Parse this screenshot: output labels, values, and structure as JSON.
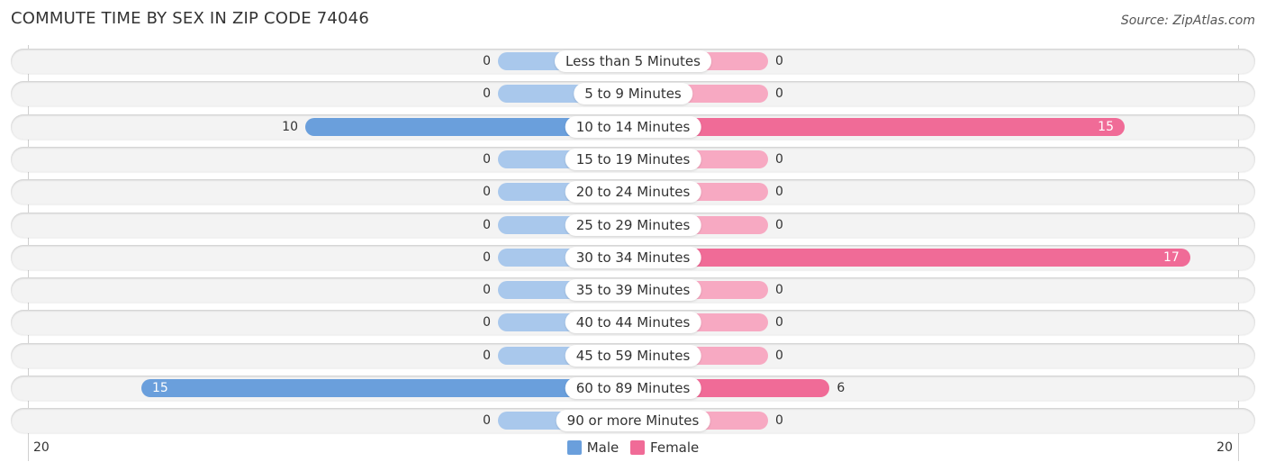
{
  "title": "COMMUTE TIME BY SEX IN ZIP CODE 74046",
  "source": "Source: ZipAtlas.com",
  "colors": {
    "male": "#6a9fdc",
    "male_light": "#a9c8ec",
    "female": "#f06b97",
    "female_light": "#f7a9c2"
  },
  "chart_data": {
    "type": "bar",
    "orientation": "horizontal-diverging",
    "title": "COMMUTE TIME BY SEX IN ZIP CODE 74046",
    "categories": [
      "Less than 5 Minutes",
      "5 to 9 Minutes",
      "10 to 14 Minutes",
      "15 to 19 Minutes",
      "20 to 24 Minutes",
      "25 to 29 Minutes",
      "30 to 34 Minutes",
      "35 to 39 Minutes",
      "40 to 44 Minutes",
      "45 to 59 Minutes",
      "60 to 89 Minutes",
      "90 or more Minutes"
    ],
    "series": [
      {
        "name": "Male",
        "values": [
          0,
          0,
          10,
          0,
          0,
          0,
          0,
          0,
          0,
          0,
          15,
          0
        ]
      },
      {
        "name": "Female",
        "values": [
          0,
          0,
          15,
          0,
          0,
          0,
          17,
          0,
          0,
          0,
          6,
          0
        ]
      }
    ],
    "xlim": [
      -20,
      20
    ],
    "tick_labels": {
      "left": "20",
      "right": "20"
    },
    "legend": {
      "position": "bottom-center",
      "entries": [
        "Male",
        "Female"
      ]
    },
    "grid": false
  }
}
